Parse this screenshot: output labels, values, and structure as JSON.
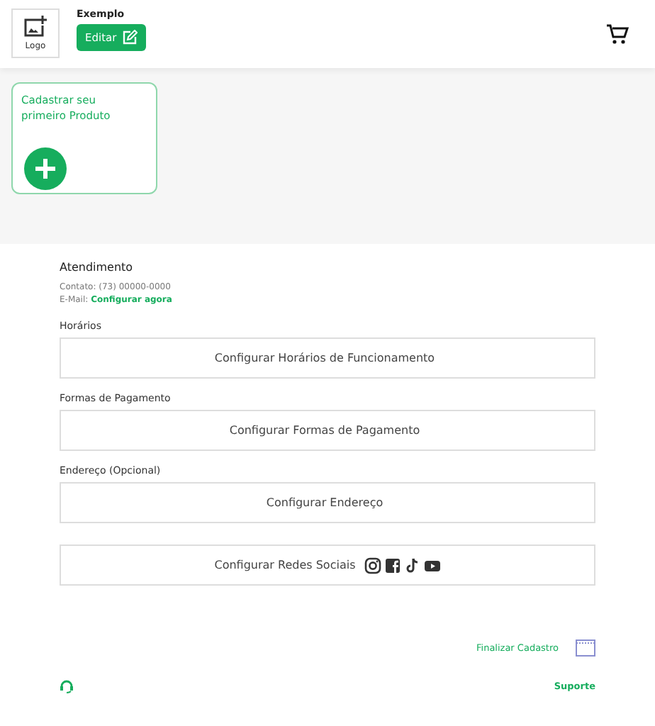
{
  "header": {
    "logo_label": "Logo",
    "store_name": "Exemplo",
    "edit_button": "Editar"
  },
  "product_card": {
    "title": "Cadastrar seu primeiro Produto"
  },
  "attendance": {
    "title": "Atendimento",
    "contact": "Contato: (73) 00000-0000",
    "email_label": "E-Mail:",
    "email_link": "Configurar agora"
  },
  "sections": [
    {
      "label": "Horários",
      "button": "Configurar Horários de Funcionamento",
      "social_icons": false
    },
    {
      "label": "Formas de Pagamento",
      "button": "Configurar Formas de Pagamento",
      "social_icons": false
    },
    {
      "label": "Endereço (Opcional)",
      "button": "Configurar Endereço",
      "social_icons": false
    },
    {
      "button": "Configurar Redes Sociais",
      "social_icons": true
    }
  ],
  "finish_link": "Finalizar Cadastro",
  "support_link": "Suporte"
}
